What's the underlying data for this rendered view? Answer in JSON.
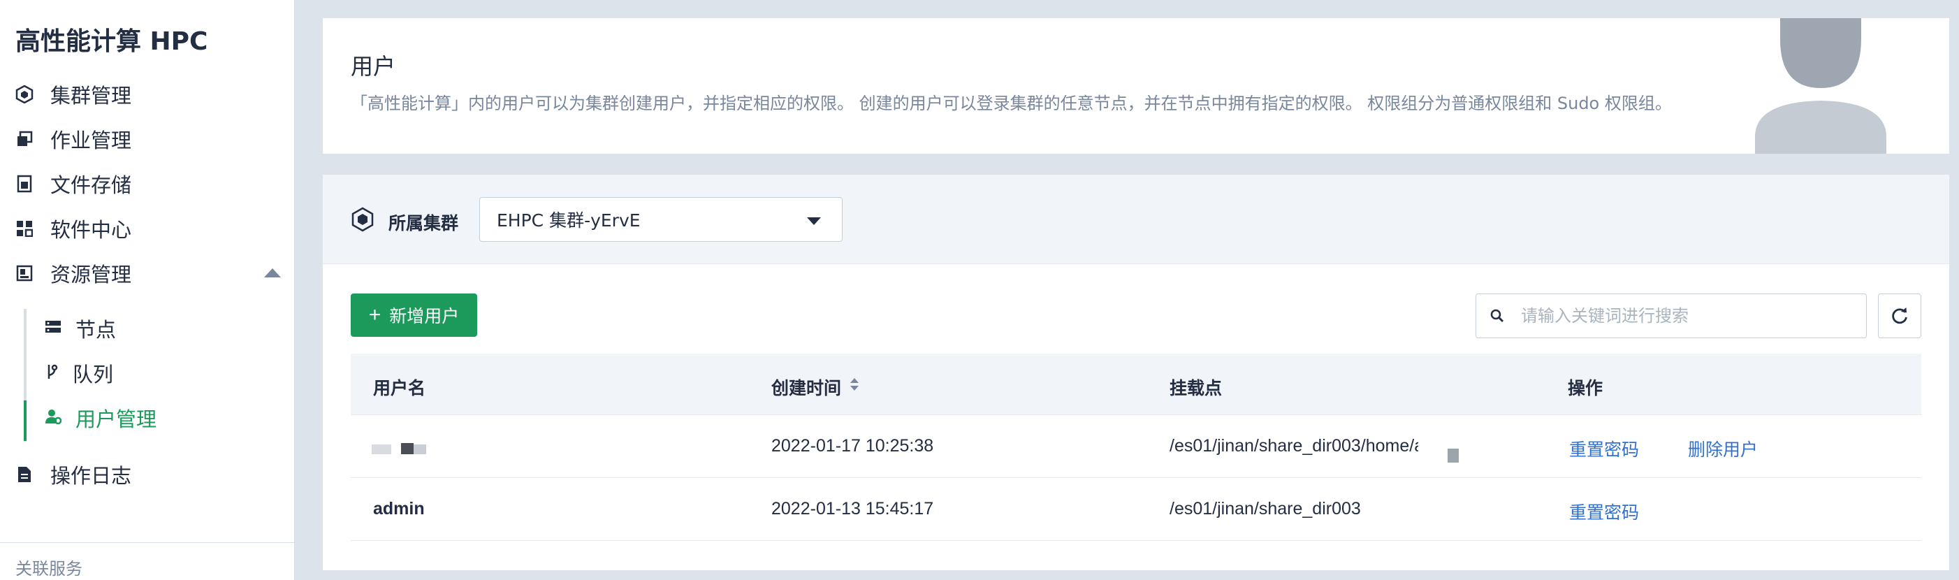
{
  "app": {
    "title": "高性能计算 HPC"
  },
  "sidebar": {
    "items": [
      {
        "label": "集群管理",
        "icon": "cluster-icon"
      },
      {
        "label": "作业管理",
        "icon": "jobs-icon"
      },
      {
        "label": "文件存储",
        "icon": "file-storage-icon"
      },
      {
        "label": "软件中心",
        "icon": "software-grid-icon"
      },
      {
        "label": "资源管理",
        "icon": "resource-icon",
        "expanded": true
      },
      {
        "label": "操作日志",
        "icon": "log-icon"
      }
    ],
    "sub_items": [
      {
        "label": "节点",
        "icon": "server-icon"
      },
      {
        "label": "队列",
        "icon": "queue-branch-icon"
      },
      {
        "label": "用户管理",
        "icon": "user-manage-icon",
        "active": true
      }
    ],
    "related_services": "关联服务"
  },
  "header": {
    "title": "用户",
    "description": "「高性能计算」内的用户可以为集群创建用户，并指定相应的权限。 创建的用户可以登录集群的任意节点，并在节点中拥有指定的权限。 权限组分为普通权限组和 Sudo 权限组。"
  },
  "cluster": {
    "label": "所属集群",
    "selected": "EHPC 集群-yErvE"
  },
  "toolbar": {
    "add_label": "新增用户",
    "search_placeholder": "请输入关键词进行搜索"
  },
  "table": {
    "columns": [
      "用户名",
      "创建时间",
      "挂载点",
      "操作"
    ],
    "rows": [
      {
        "username": "",
        "created": "2022-01-17 10:25:38",
        "mount": "/es01/jinan/share_dir003/home/a",
        "actions": [
          "重置密码",
          "删除用户"
        ]
      },
      {
        "username": "admin",
        "created": "2022-01-13 15:45:17",
        "mount": "/es01/jinan/share_dir003",
        "actions": [
          "重置密码"
        ]
      }
    ]
  },
  "colors": {
    "accent": "#1b9a5c",
    "link": "#3370cc",
    "text": "#242e42",
    "muted": "#79879c",
    "background": "#dde3ea"
  }
}
